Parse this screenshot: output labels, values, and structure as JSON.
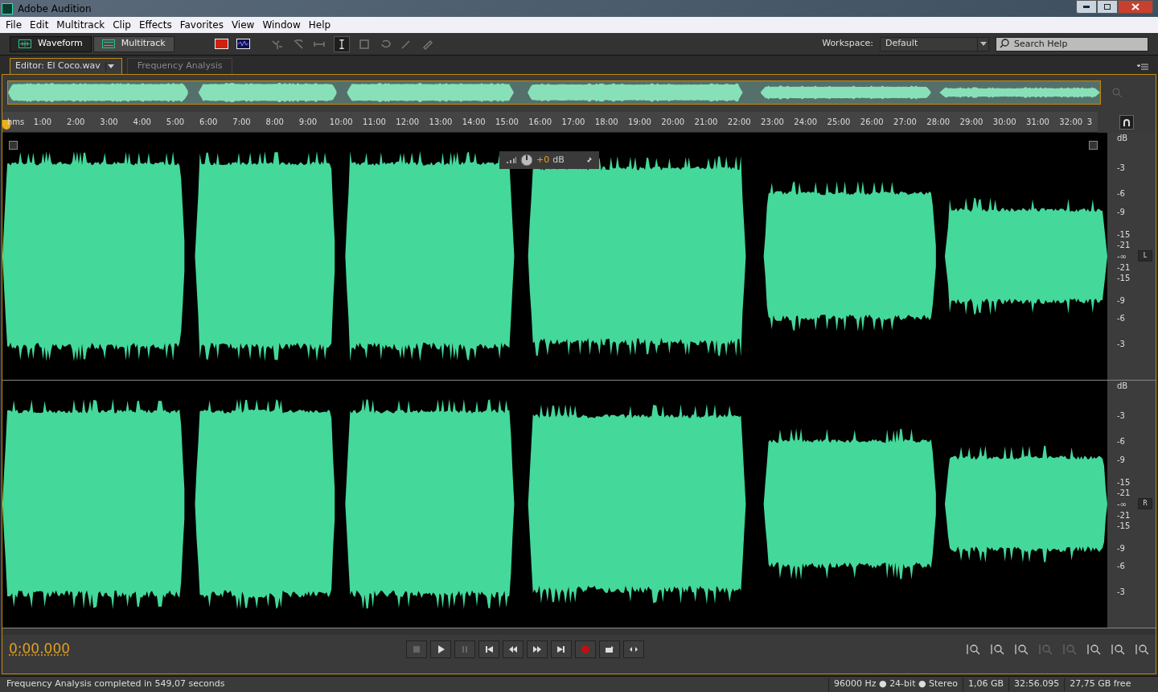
{
  "window": {
    "title": "Adobe Audition"
  },
  "menu": [
    "File",
    "Edit",
    "Multitrack",
    "Clip",
    "Effects",
    "Favorites",
    "View",
    "Window",
    "Help"
  ],
  "views": [
    {
      "label": "Waveform",
      "selected": true
    },
    {
      "label": "Multitrack",
      "selected": false
    }
  ],
  "workspace": {
    "label": "Workspace:",
    "value": "Default"
  },
  "search": {
    "placeholder": "Search Help"
  },
  "tabs": [
    {
      "label": "Editor: El Coco.wav",
      "selected": true
    },
    {
      "label": "Frequency Analysis",
      "selected": false
    }
  ],
  "ruler": {
    "unit": "hms",
    "ticks": [
      "1:00",
      "2:00",
      "3:00",
      "4:00",
      "5:00",
      "6:00",
      "7:00",
      "8:00",
      "9:00",
      "10:00",
      "11:00",
      "12:00",
      "13:00",
      "14:00",
      "15:00",
      "16:00",
      "17:00",
      "18:00",
      "19:00",
      "20:00",
      "21:00",
      "22:00",
      "23:00",
      "24:00",
      "25:00",
      "26:00",
      "27:00",
      "28:00",
      "29:00",
      "30:00",
      "31:00",
      "32:00",
      "3"
    ]
  },
  "hud": {
    "value": "+0",
    "unit": "dB"
  },
  "channels": [
    {
      "label": "L",
      "scale": [
        "dB",
        "-3",
        "-6",
        "-9",
        "-15",
        "-21",
        "-∞",
        "-21",
        "-15",
        "-9",
        "-6",
        "-3"
      ]
    },
    {
      "label": "R",
      "scale": [
        "dB",
        "-3",
        "-6",
        "-9",
        "-15",
        "-21",
        "-∞",
        "-21",
        "-15",
        "-9",
        "-6",
        "-3"
      ]
    }
  ],
  "time": "0:00.000",
  "status": {
    "message": "Frequency Analysis completed in 549,07 seconds",
    "fields": [
      "96000 Hz ● 24-bit ● Stereo",
      "1,06 GB",
      "32:56.095",
      "27,75 GB free"
    ]
  }
}
